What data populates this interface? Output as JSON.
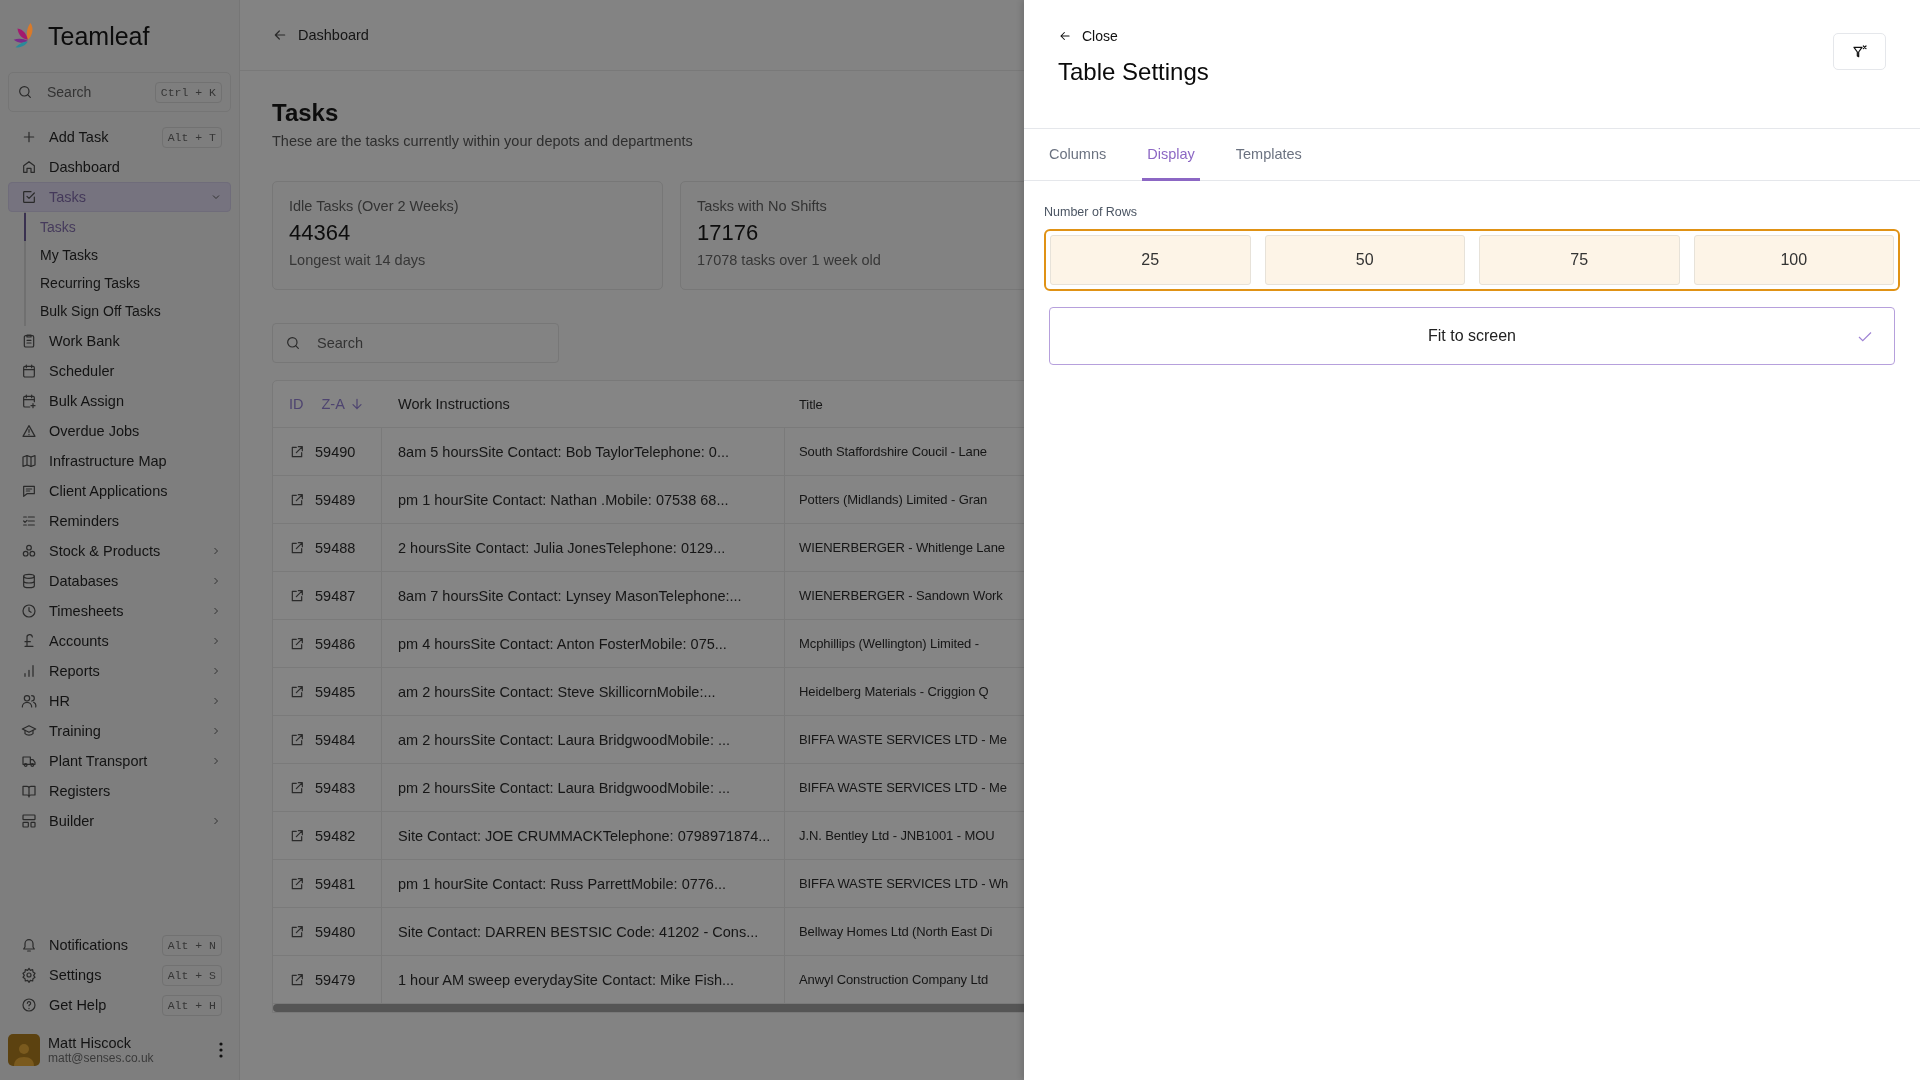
{
  "sidebar": {
    "brand": "Teamleaf",
    "search": {
      "placeholder": "Search",
      "shortcut": "Ctrl + K"
    },
    "items": [
      {
        "label": "Add Task",
        "shortcut": "Alt + T",
        "selected": false
      },
      {
        "label": "Dashboard",
        "selected": false
      },
      {
        "label": "Tasks",
        "expanded": true,
        "selected": true,
        "children": [
          {
            "label": "Tasks",
            "selected": true
          },
          {
            "label": "My Tasks",
            "selected": false
          },
          {
            "label": "Recurring Tasks",
            "selected": false
          },
          {
            "label": "Bulk Sign Off Tasks",
            "selected": false
          }
        ]
      },
      {
        "label": "Work Bank",
        "selected": false
      },
      {
        "label": "Scheduler",
        "selected": false
      },
      {
        "label": "Bulk Assign",
        "selected": false
      },
      {
        "label": "Overdue Jobs",
        "selected": false
      },
      {
        "label": "Infrastructure Map",
        "selected": false
      },
      {
        "label": "Client Applications",
        "selected": false
      },
      {
        "label": "Reminders",
        "selected": false
      },
      {
        "label": "Stock & Products",
        "expanded": false,
        "selected": false
      },
      {
        "label": "Databases",
        "expanded": false,
        "selected": false
      },
      {
        "label": "Timesheets",
        "expanded": false,
        "selected": false
      },
      {
        "label": "Accounts",
        "expanded": false,
        "selected": false
      },
      {
        "label": "Reports",
        "expanded": false,
        "selected": false
      },
      {
        "label": "HR",
        "expanded": false,
        "selected": false
      },
      {
        "label": "Training",
        "expanded": false,
        "selected": false
      },
      {
        "label": "Plant Transport",
        "expanded": false,
        "selected": false
      },
      {
        "label": "Registers",
        "selected": false
      },
      {
        "label": "Builder",
        "expanded": false,
        "selected": false
      }
    ],
    "footer_items": [
      {
        "label": "Notifications",
        "shortcut": "Alt + N"
      },
      {
        "label": "Settings",
        "shortcut": "Alt + S"
      },
      {
        "label": "Get Help",
        "shortcut": "Alt + H"
      }
    ],
    "user": {
      "name": "Matt Hiscock",
      "email": "matt@senses.co.uk"
    }
  },
  "breadcrumb": {
    "label": "Dashboard"
  },
  "page": {
    "title": "Tasks",
    "subtitle": "These are the tasks currently within your depots and departments"
  },
  "stats": [
    {
      "label": "Idle Tasks (Over 2 Weeks)",
      "value": "44364",
      "note": "Longest wait 14 days"
    },
    {
      "label": "Tasks with No Shifts",
      "value": "17176",
      "note": "17078 tasks over 1 week old"
    }
  ],
  "search": {
    "placeholder": "Search"
  },
  "table": {
    "columns": [
      {
        "label": "ID",
        "sort": "Z-A"
      },
      {
        "label": "Work Instructions"
      },
      {
        "label": "Title"
      }
    ],
    "rows": [
      {
        "id": "59490",
        "instructions": "8am 5 hoursSite Contact: Bob TaylorTelephone: 0...",
        "title": "South Staffordshire Coucil - Lane"
      },
      {
        "id": "59489",
        "instructions": "pm 1 hourSite Contact: Nathan .Mobile: 07538 68...",
        "title": "Potters (Midlands) Limited - Gran"
      },
      {
        "id": "59488",
        "instructions": "2 hoursSite Contact: Julia JonesTelephone: 0129...",
        "title": "WIENERBERGER - Whitlenge Lane"
      },
      {
        "id": "59487",
        "instructions": "8am 7 hoursSite Contact: Lynsey MasonTelephone:...",
        "title": "WIENERBERGER - Sandown Work"
      },
      {
        "id": "59486",
        "instructions": "pm 4 hoursSite Contact: Anton FosterMobile: 075...",
        "title": "Mcphillips (Wellington) Limited -"
      },
      {
        "id": "59485",
        "instructions": "am 2 hoursSite Contact: Steve SkillicornMobile:...",
        "title": "Heidelberg Materials - Criggion Q"
      },
      {
        "id": "59484",
        "instructions": "am 2 hoursSite Contact: Laura BridgwoodMobile: ...",
        "title": "BIFFA WASTE SERVICES LTD - Me"
      },
      {
        "id": "59483",
        "instructions": "pm 2 hoursSite Contact: Laura BridgwoodMobile: ...",
        "title": "BIFFA WASTE SERVICES LTD - Me"
      },
      {
        "id": "59482",
        "instructions": "Site Contact: JOE CRUMMACKTelephone: 0798971874...",
        "title": "J.N. Bentley Ltd - JNB1001 - MOU"
      },
      {
        "id": "59481",
        "instructions": "pm 1 hourSite Contact: Russ ParrettMobile: 0776...",
        "title": "BIFFA WASTE SERVICES LTD - Wh"
      },
      {
        "id": "59480",
        "instructions": "Site Contact: DARREN BESTSIC Code: 41202 - Cons...",
        "title": "Bellway Homes Ltd (North East Di"
      },
      {
        "id": "59479",
        "instructions": "1 hour AM sweep everydaySite Contact: Mike Fish...",
        "title": "Anwyl Construction Company Ltd"
      }
    ]
  },
  "panel": {
    "back_label": "Close",
    "title": "Table Settings",
    "tabs": [
      {
        "label": "Columns",
        "selected": false
      },
      {
        "label": "Display",
        "selected": true
      },
      {
        "label": "Templates",
        "selected": false
      }
    ],
    "rows_setting": {
      "label": "Number of Rows",
      "focused": true,
      "options": [
        {
          "label": "25",
          "selected": false
        },
        {
          "label": "50",
          "selected": false
        },
        {
          "label": "75",
          "selected": false
        },
        {
          "label": "100",
          "selected": false
        }
      ]
    },
    "fit_to_screen": {
      "label": "Fit to screen",
      "checked": true
    }
  }
}
